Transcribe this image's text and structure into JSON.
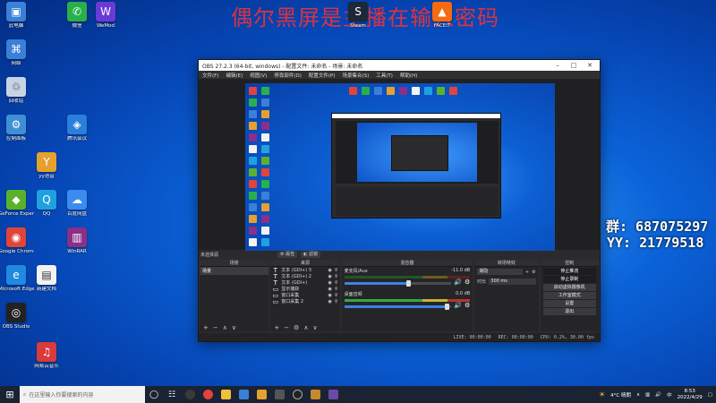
{
  "banner": {
    "text": "偶尔黑屏是主播在输入密码"
  },
  "overlay": {
    "group": "群: 687075297",
    "yy": "YY: 21779518"
  },
  "desktop": {
    "icons": [
      {
        "label": "此电脑",
        "color": "#3a7fd8",
        "glyph": "▣"
      },
      {
        "label": "网络",
        "color": "#3a7fd8",
        "glyph": "⌘"
      },
      {
        "label": "回收站",
        "color": "#c8d4e6",
        "glyph": "♲"
      },
      {
        "label": "控制面板",
        "color": "#3f8fd6",
        "glyph": "⚙"
      },
      {
        "label": "GeForce Experience",
        "color": "#5bb12a",
        "glyph": "◆"
      },
      {
        "label": "Google Chrome",
        "color": "#e0443a",
        "glyph": "◉"
      },
      {
        "label": "Microsoft Edge",
        "color": "#1f8ae0",
        "glyph": "e"
      },
      {
        "label": "OBS Studio",
        "color": "#222",
        "glyph": "◎"
      },
      {
        "label": "网易云音乐",
        "color": "#d83b3b",
        "glyph": "♫"
      },
      {
        "label": "yy语音",
        "color": "#e4a12e",
        "glyph": "Y"
      },
      {
        "label": "腾讯会议",
        "color": "#2a7fdc",
        "glyph": "◈"
      },
      {
        "label": "Steam",
        "color": "#1b2838",
        "glyph": "S"
      },
      {
        "label": "百度网盘",
        "color": "#3b8cf0",
        "glyph": "☁"
      },
      {
        "label": "QQ",
        "color": "#1fa1e0",
        "glyph": "Q"
      },
      {
        "label": "WinRAR",
        "color": "#8a2f8a",
        "glyph": "▥"
      },
      {
        "label": "新建文档",
        "color": "#f2f2f2",
        "glyph": "▤"
      },
      {
        "label": "微信",
        "color": "#2ab04a",
        "glyph": "✆"
      },
      {
        "label": "FACEIT",
        "color": "#f56b12",
        "glyph": "▲"
      },
      {
        "label": "WeMod",
        "color": "#6a3ad8",
        "glyph": "W"
      }
    ]
  },
  "obs": {
    "title": "OBS 27.2.3 (64-bit, windows) - 配置文件: 未命名 - 场景: 未命名",
    "menu": [
      "文件(F)",
      "编辑(E)",
      "视图(V)",
      "停靠部件(D)",
      "配置文件(P)",
      "场景集合(S)",
      "工具(T)",
      "帮助(H)"
    ],
    "toolbar": {
      "label": "未选择源",
      "properties": "⚙ 属性",
      "filters": "◐ 滤镜"
    },
    "docks": {
      "scenes": {
        "title": "场景",
        "items": [
          "场景"
        ]
      },
      "sources": {
        "title": "来源",
        "items": [
          {
            "glyph": "T",
            "name": "文本 (GDI+) 3"
          },
          {
            "glyph": "T",
            "name": "文本 (GDI+) 2"
          },
          {
            "glyph": "T",
            "name": "文本 (GDI+)"
          },
          {
            "glyph": "▭",
            "name": "显示捕获"
          },
          {
            "glyph": "▭",
            "name": "窗口采集"
          },
          {
            "glyph": "▭",
            "name": "窗口采集 2"
          }
        ]
      },
      "mixer": {
        "title": "混音器",
        "tracks": [
          {
            "name": "麦克风/Aux",
            "db": "-11.0 dB"
          },
          {
            "name": "桌面音频",
            "db": "0.0 dB"
          }
        ]
      },
      "transitions": {
        "title": "转场特效",
        "type": "渐隐",
        "duration_label": "时长",
        "duration": "300 ms"
      },
      "controls": {
        "title": "控制",
        "buttons": [
          "停止推流",
          "停止录制",
          "启动虚拟摄像机",
          "工作室模式",
          "设置",
          "退出"
        ]
      }
    },
    "status": {
      "live": "LIVE: 00:00:00",
      "rec": "REC: 00:00:00",
      "cpu": "CPU: 0.2%, 30.00 fps"
    }
  },
  "taskbar": {
    "search_placeholder": "在这里输入你要搜索的内容",
    "weather": "4°C 晴朗",
    "time": "8:53",
    "date": "2022/4/29"
  }
}
